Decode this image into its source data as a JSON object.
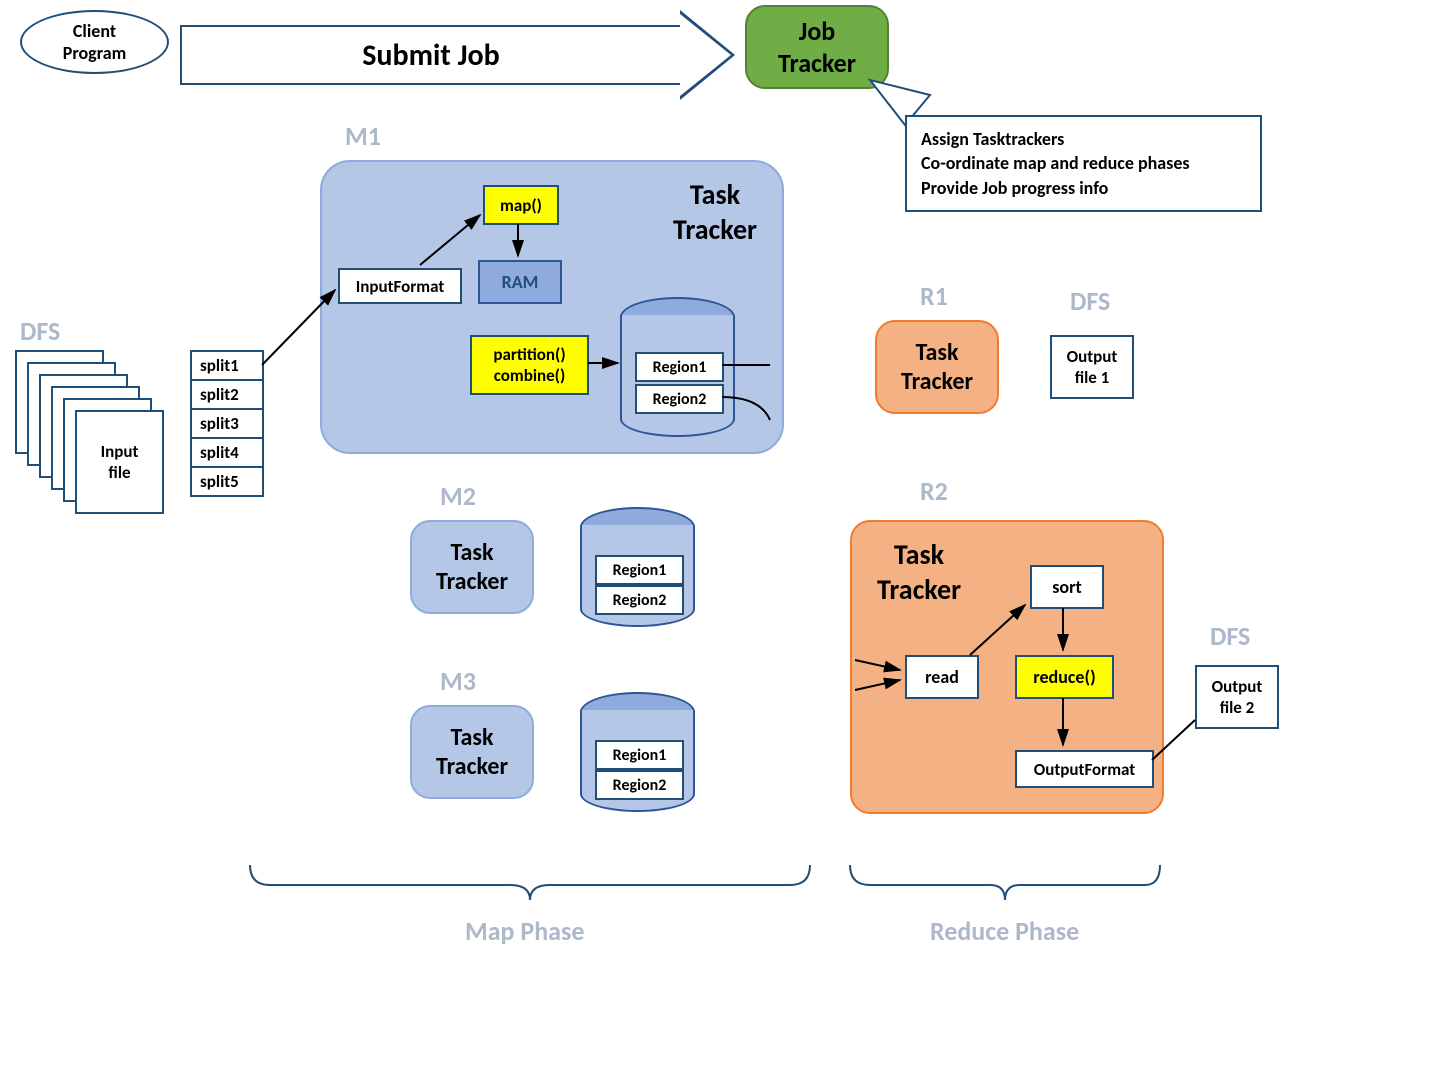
{
  "client": {
    "label": "Client\nProgram"
  },
  "submit_arrow": {
    "label": "Submit Job"
  },
  "job_tracker": {
    "label": "Job\nTracker"
  },
  "callout": {
    "line1": "Assign Tasktrackers",
    "line2": "Co-ordinate map and reduce phases",
    "line3": "Provide Job progress info"
  },
  "labels": {
    "dfs_left": "DFS",
    "dfs_r1": "DFS",
    "dfs_r2": "DFS",
    "m1": "M1",
    "m2": "M2",
    "m3": "M3",
    "r1": "R1",
    "r2": "R2",
    "map_phase": "Map Phase",
    "reduce_phase": "Reduce Phase"
  },
  "input_file": "Input\nfile",
  "splits": [
    "split1",
    "split2",
    "split3",
    "split4",
    "split5"
  ],
  "m1_detail": {
    "tt": "Task\nTracker",
    "input_format": "InputFormat",
    "map": "map()",
    "ram": "RAM",
    "partition": "partition()\ncombine()",
    "region1": "Region1",
    "region2": "Region2"
  },
  "m2": {
    "tt": "Task\nTracker",
    "region1": "Region1",
    "region2": "Region2"
  },
  "m3": {
    "tt": "Task\nTracker",
    "region1": "Region1",
    "region2": "Region2"
  },
  "r1": {
    "tt": "Task\nTracker",
    "output": "Output\nfile 1"
  },
  "r2": {
    "tt": "Task\nTracker",
    "read": "read",
    "sort": "sort",
    "reduce": "reduce()",
    "output_format": "OutputFormat",
    "output": "Output\nfile 2"
  }
}
